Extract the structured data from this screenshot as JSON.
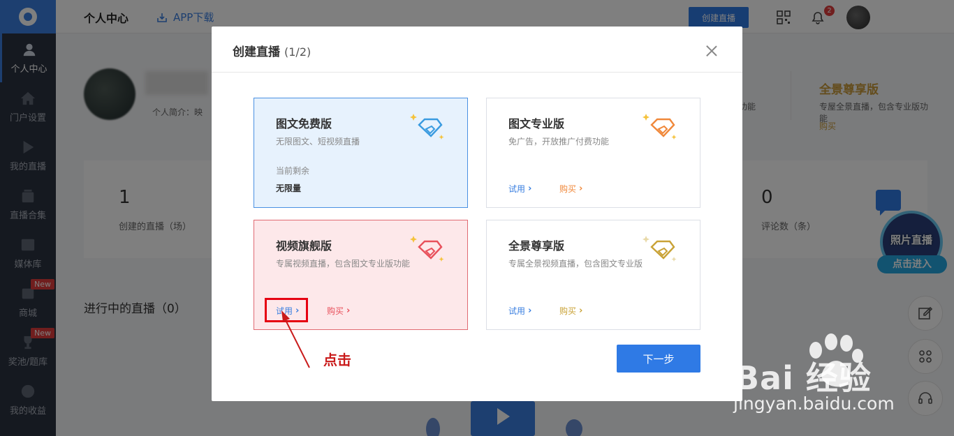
{
  "sidebar": {
    "items": [
      {
        "label": "个人中心",
        "icon": "user-icon",
        "active": true
      },
      {
        "label": "门户设置",
        "icon": "home-icon"
      },
      {
        "label": "我的直播",
        "icon": "play-icon"
      },
      {
        "label": "直播合集",
        "icon": "collection-icon"
      },
      {
        "label": "媒体库",
        "icon": "film-icon"
      },
      {
        "label": "商城",
        "icon": "shop-icon",
        "badge": "New"
      },
      {
        "label": "奖池/题库",
        "icon": "trophy-icon",
        "badge": "New"
      },
      {
        "label": "我的收益",
        "icon": "earnings-icon"
      }
    ]
  },
  "header": {
    "title": "个人中心",
    "app_download": "APP下载",
    "create_button": "创建直播",
    "notification_count": "2"
  },
  "profile": {
    "bio_label": "个人简介：映",
    "vip_title": "全景尊享版",
    "vip_desc": "专屋全景直播，包含专业版功能",
    "vip_buy": "购买",
    "func_text": "功能"
  },
  "stats": [
    {
      "value": "1",
      "label": "创建的直播（场）"
    },
    {
      "value": "0",
      "label": "评论数（条）"
    }
  ],
  "live_section_title": "进行中的直播（0）",
  "promo": {
    "title": "照片直播",
    "cta": "点击进入"
  },
  "modal": {
    "title": "创建直播",
    "step": "(1/2)",
    "cards": [
      {
        "title": "图文免费版",
        "desc": "无限图文、短视频直播",
        "remain_label": "当前剩余",
        "remain_value": "无限量",
        "gem_color": "#3a9be0"
      },
      {
        "title": "图文专业版",
        "desc": "免广告，开放推广付费功能",
        "try": "试用",
        "buy": "购买",
        "gem_color": "#f0883a",
        "buy_color": "#f0883a"
      },
      {
        "title": "视频旗舰版",
        "desc": "专属视频直播，包含图文专业版功能",
        "try": "试用",
        "buy": "购买",
        "gem_color": "#e8505b",
        "buy_color": "#e8505b"
      },
      {
        "title": "全景尊享版",
        "desc": "专属全景视频直播，包含图文专业版",
        "try": "试用",
        "buy": "购买",
        "gem_color": "#c9a236",
        "buy_color": "#c9a236"
      }
    ],
    "annotation": "点击",
    "next_button": "下一步"
  },
  "watermark": {
    "brand": "Bai  经验",
    "url": "jingyan.baidu.com"
  }
}
